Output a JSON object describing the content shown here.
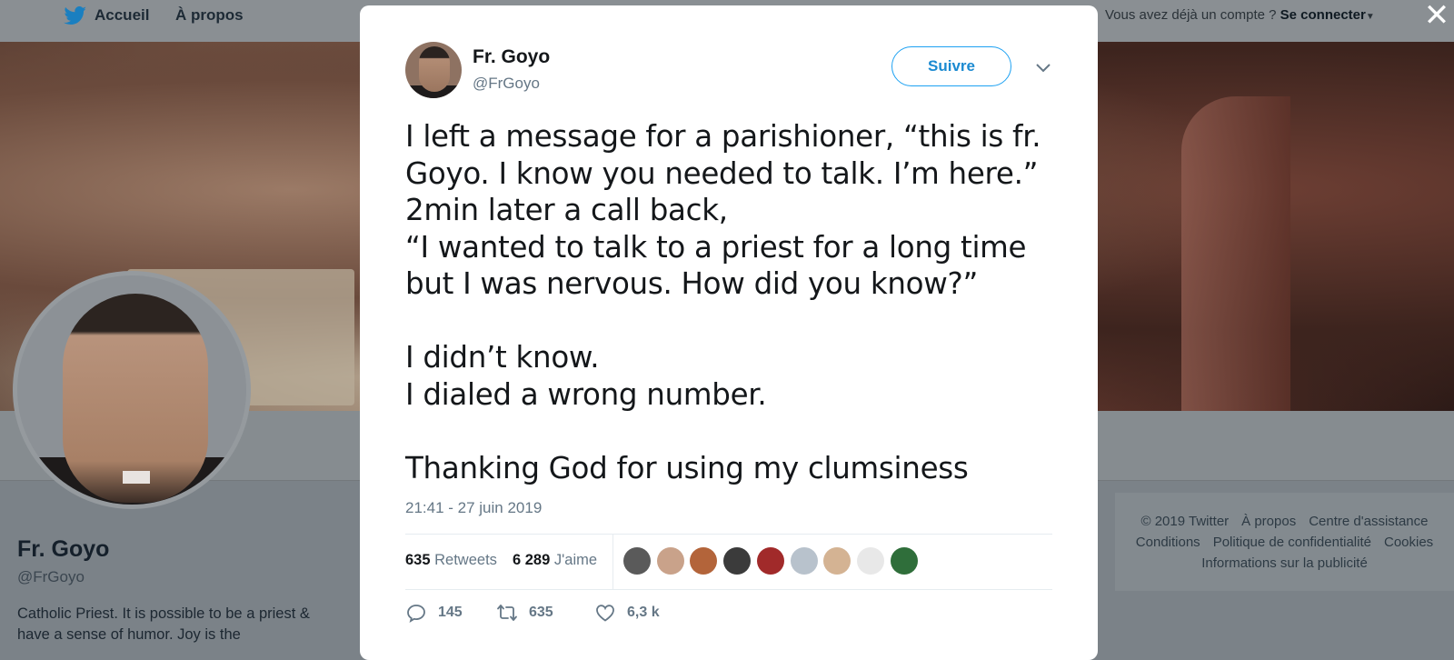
{
  "nav": {
    "home_label": "Accueil",
    "about_label": "À propos"
  },
  "login": {
    "prompt": "Vous avez déjà un compte ?",
    "action": "Se connecter"
  },
  "profile": {
    "name": "Fr. Goyo",
    "handle": "@FrGoyo",
    "bio": "Catholic Priest. It is possible to be a priest & have a sense of humor. Joy is the"
  },
  "footer": {
    "links": [
      "© 2019 Twitter",
      "À propos",
      "Centre d'assistance",
      "Conditions",
      "Politique de confidentialité",
      "Cookies",
      "Informations sur la publicité"
    ]
  },
  "tweet": {
    "author_name": "Fr. Goyo",
    "author_handle": "@FrGoyo",
    "follow_label": "Suivre",
    "text": "I left a message for a parishioner, “this is fr.\nGoyo. I know you needed to talk. I’m here.”\n2min later a call back,\n“I wanted to talk to a priest for a long time\nbut I was nervous. How did you know?”\n\nI didn’t know.\nI dialed a wrong number.\n\nThanking God for using my clumsiness",
    "timestamp": "21:41 - 27 juin 2019",
    "retweets_count": "635",
    "retweets_label": "Retweets",
    "likes_count": "6 289",
    "likes_label": "J'aime",
    "replies_action": "145",
    "retweets_action": "635",
    "likes_action": "6,3 k"
  },
  "likers_colors": [
    "#5a5a5a",
    "#c9a28a",
    "#b3643a",
    "#3b3b3b",
    "#a12a2a",
    "#b8c2cc",
    "#d4b393",
    "#e8e8e8",
    "#2f6e3a"
  ],
  "colors": {
    "accent": "#1da1f2",
    "text": "#14171a",
    "muted": "#657786"
  }
}
